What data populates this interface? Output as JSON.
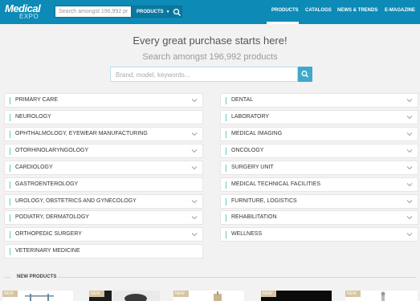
{
  "header": {
    "logo_top": "Medical",
    "logo_bottom": "EXPO",
    "search_placeholder": "Search amongst 196,992 pr",
    "search_scope": "PRODUCTS",
    "nav": [
      "PRODUCTS",
      "CATALOGS",
      "NEWS & TRENDS",
      "E-MAGAZINE"
    ],
    "nav_active": "PRODUCTS",
    "brand_color": "#0d8ab6"
  },
  "hero": {
    "title": "Every great purchase starts here!",
    "subtitle": "Search amongst 196,992 products",
    "search_placeholder": "Brand, model, keywords..."
  },
  "categories": {
    "left": [
      "PRIMARY CARE",
      "NEUROLOGY",
      "OPHTHALMOLOGY, EYEWEAR MANUFACTURING",
      "OTORHINOLARYNGOLOGY",
      "CARDIOLOGY",
      "GASTROENTEROLOGY",
      "UROLOGY, OBSTETRICS AND GYNECOLOGY",
      "PODIATRY, DERMATOLOGY",
      "ORTHOPEDIC SURGERY",
      "VETERINARY MEDICINE"
    ],
    "right": [
      "DENTAL",
      "LABORATORY",
      "MEDICAL IMAGING",
      "ONCOLOGY",
      "SURGERY UNIT",
      "MEDICAL TECHNICAL FACILITIES",
      "FURNITURE, LOGISTICS",
      "REHABILITATION",
      "WELLNESS"
    ],
    "accent_color": "#5fc8c6"
  },
  "new_products": {
    "title": "NEW PRODUCTS",
    "badge": "NEW"
  }
}
